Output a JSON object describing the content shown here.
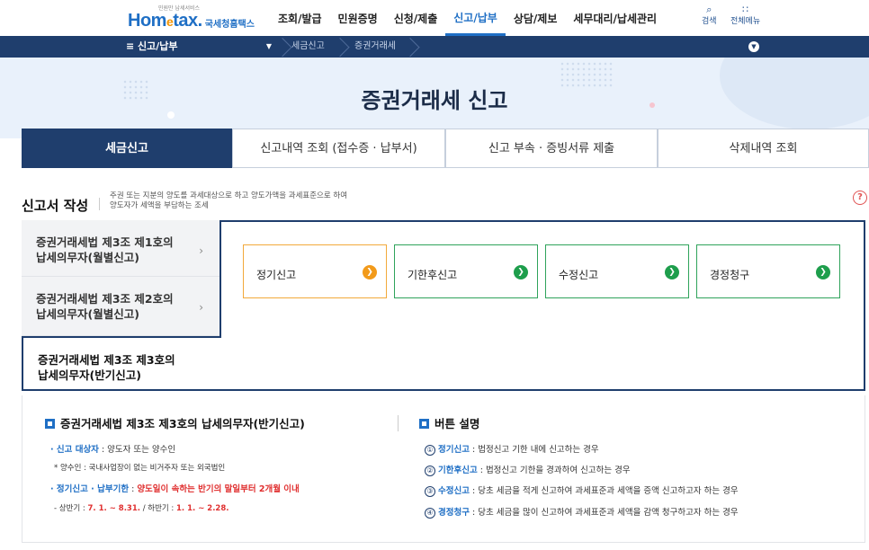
{
  "header": {
    "logo_sub": "민원만 납세서비스",
    "logo_main_a": "Hom",
    "logo_main_e": "e",
    "logo_main_b": "tax.",
    "logo_kr": "국세청홈택스",
    "gnb": [
      "조회/발급",
      "민원증명",
      "신청/제출",
      "신고/납부",
      "상담/제보",
      "세무대리/납세관리"
    ],
    "active_gnb": "신고/납부",
    "search_label": "검색",
    "allmenu_label": "전체메뉴"
  },
  "breadcrumb": {
    "menu_label": "≡  신고/납부",
    "items": [
      "세금신고",
      "증권거래세"
    ]
  },
  "hero": {
    "title": "증권거래세 신고"
  },
  "tabs": [
    "세금신고",
    "신고내역 조회 (접수증 · 납부서)",
    "신고 부속 · 증빙서류 제출",
    "삭제내역 조회"
  ],
  "section": {
    "title": "신고서 작성",
    "desc_line1": "주권 또는 지분의 양도를 과세대상으로 하고 양도가액을 과세표준으로 하여",
    "desc_line2": "양도자가 세액을 부담하는 조세",
    "help": "?"
  },
  "left_items": [
    {
      "line1": "증권거래세법 제3조 제1호의",
      "line2": "납세의무자(월별신고)"
    },
    {
      "line1": "증권거래세법 제3조 제2호의",
      "line2": "납세의무자(월별신고)"
    },
    {
      "line1": "증권거래세법 제3조 제3호의",
      "line2": "납세의무자(반기신고)"
    }
  ],
  "options": [
    "정기신고",
    "기한후신고",
    "수정신고",
    "경정청구"
  ],
  "info_left": {
    "title": "증권거래세법 제3조 제3호의 납세의무자(반기신고)",
    "l1_key": "· 신고 대상자",
    "l1_val": " : 양도자 또는 양수인",
    "l2": "* 양수인 : 국내사업장이 없는 비거주자 또는 외국법인",
    "l3_key": "· 정기신고 · 납부기한",
    "l3_colon": " : ",
    "l3_val": "양도일이 속하는 반기의 말일부터 2개월 이내",
    "l4_a": "- 상반기 : ",
    "l4_b": "7. 1. ~ 8.31.",
    "l4_c": " / 하반기 : ",
    "l4_d": "1. 1. ~ 2.28."
  },
  "info_right": {
    "title": "버튼 설명",
    "items": [
      {
        "n": "①",
        "key": "정기신고",
        "val": " : 법정신고 기한 내에 신고하는 경우"
      },
      {
        "n": "②",
        "key": "기한후신고",
        "val": " : 법정신고 기한을 경과하여 신고하는 경우"
      },
      {
        "n": "③",
        "key": "수정신고",
        "val": " : 당초 세금을 적게 신고하여 과세표준과 세액을 증액 신고하고자 하는 경우"
      },
      {
        "n": "④",
        "key": "경정청구",
        "val": " : 당초 세금을 많이 신고하여 과세표준과 세액을 감액 청구하고자 하는 경우"
      }
    ]
  },
  "colors": {
    "navy": "#1f3e6d",
    "brand_blue": "#1f6fc5",
    "green": "#1e9e4c",
    "orange": "#f29a1a",
    "red": "#e03030"
  }
}
